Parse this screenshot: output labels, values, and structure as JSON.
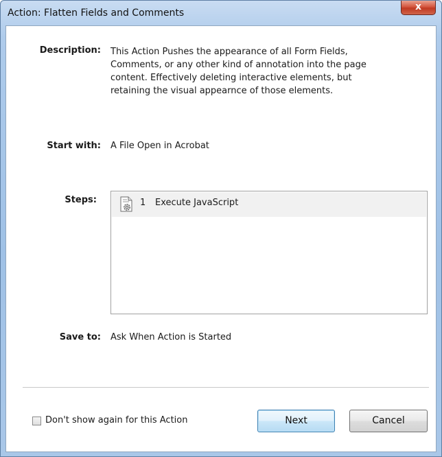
{
  "window": {
    "title": "Action: Flatten Fields and Comments",
    "close_glyph": "x"
  },
  "description": {
    "label": "Description:",
    "text": "This Action Pushes the appearance of all Form Fields, Comments, or any other kind of annotation into the page content.  Effectively deleting interactive elements, but retaining the visual appearnce of those elements."
  },
  "start_with": {
    "label": "Start with:",
    "value": "A File Open in Acrobat"
  },
  "steps": {
    "label": "Steps:",
    "items": [
      {
        "number": "1",
        "name": "Execute JavaScript",
        "icon": "script-gear-icon"
      }
    ]
  },
  "save_to": {
    "label": "Save to:",
    "value": "Ask When Action is Started"
  },
  "footer": {
    "dont_show_label": "Don't show again for this Action",
    "dont_show_checked": false,
    "next_label": "Next",
    "cancel_label": "Cancel"
  },
  "colors": {
    "frame": "#a9c7e8",
    "close_button": "#c9452c",
    "default_button_border": "#3c7fb1"
  }
}
